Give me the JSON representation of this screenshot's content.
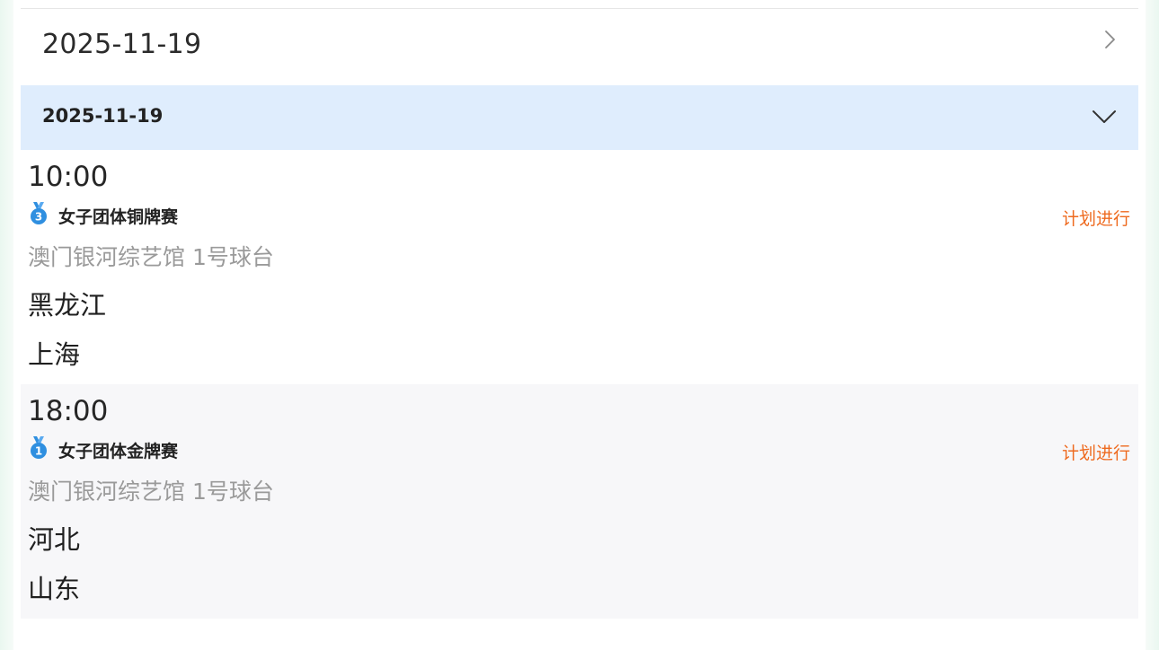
{
  "date_selector": {
    "date": "2025-11-19"
  },
  "day_group": {
    "title": "2025-11-19"
  },
  "matches": [
    {
      "time": "10:00",
      "medal": "3",
      "medal_icon": "bronze-medal-icon",
      "event": "女子团体铜牌赛",
      "status": "计划进行",
      "venue": "澳门银河综艺馆 1号球台",
      "team_a": "黑龙江",
      "team_b": "上海"
    },
    {
      "time": "18:00",
      "medal": "1",
      "medal_icon": "gold-medal-icon",
      "event": "女子团体金牌赛",
      "status": "计划进行",
      "venue": "澳门银河综艺馆 1号球台",
      "team_a": "河北",
      "team_b": "山东"
    }
  ],
  "colors": {
    "header_bg": "#dfedfd",
    "status": "#ee6a1f",
    "medal": "#2f8fe0"
  }
}
